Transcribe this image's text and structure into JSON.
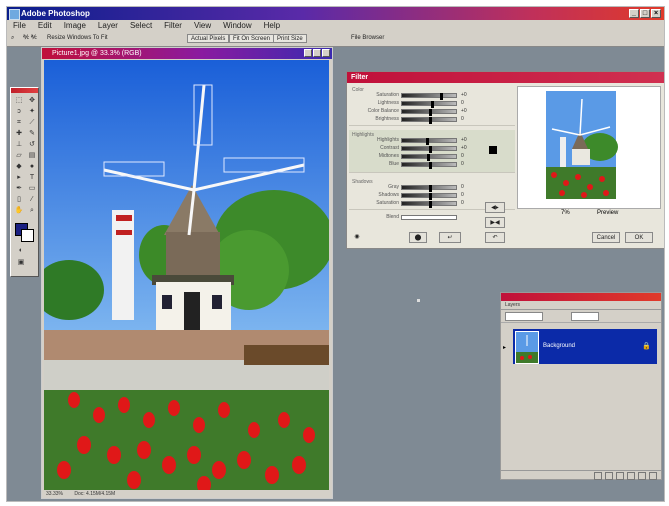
{
  "app": {
    "title": "Adobe Photoshop"
  },
  "menus": [
    "File",
    "Edit",
    "Image",
    "Layer",
    "Select",
    "Filter",
    "View",
    "Window",
    "Help"
  ],
  "options_bar": {
    "tool_readout": "℀ ℀",
    "checkbox_label": "Resize Windows To Fit",
    "actual_pixels": "Actual Pixels",
    "fit_on_screen": "Fit On Screen",
    "print_size": "Print Size",
    "right_label": "File Browser"
  },
  "document": {
    "title": "Picture1.jpg @ 33.3% (RGB)",
    "status_zoom": "33.33%",
    "status_doc": "Doc: 4.15M/4.15M"
  },
  "filter_dialog": {
    "title": "Filter",
    "sections": [
      {
        "label": "Color",
        "rows": [
          {
            "label": "Saturation",
            "value": "+0",
            "knob": 0.72
          },
          {
            "label": "Lightness",
            "value": "0",
            "knob": 0.55
          },
          {
            "label": "Color Balance",
            "value": "+0",
            "knob": 0.5
          },
          {
            "label": "Brightness",
            "value": "0",
            "knob": 0.5
          }
        ]
      },
      {
        "label": "Highlights",
        "rows": [
          {
            "label": "Highlights",
            "value": "+0",
            "knob": 0.45
          },
          {
            "label": "Contrast",
            "value": "+0",
            "knob": 0.5
          },
          {
            "label": "Midtones",
            "value": "0",
            "knob": 0.48
          },
          {
            "label": "Blue",
            "value": "0",
            "knob": 0.5
          }
        ]
      },
      {
        "label": "Shadows",
        "rows": [
          {
            "label": "Gray",
            "value": "0",
            "knob": 0.5
          },
          {
            "label": "Shadows",
            "value": "0",
            "knob": 0.5
          },
          {
            "label": "Saturation",
            "value": "0",
            "knob": 0.5
          }
        ]
      }
    ],
    "amount_label": "Blend",
    "preview_label": "Preview",
    "cancel_label": "Cancel",
    "ok_label": "OK",
    "zoom_value": "7%"
  },
  "layers_panel": {
    "tab_label": "Layers",
    "layer_name": "Background"
  }
}
